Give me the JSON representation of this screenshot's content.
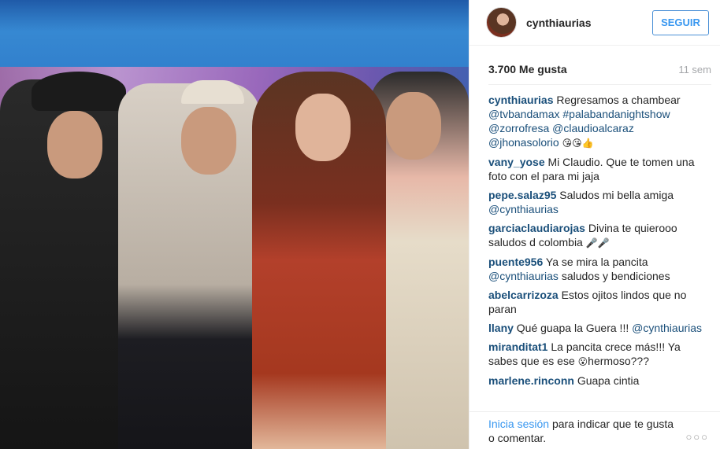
{
  "post": {
    "photo": {
      "alt_icon": "photo"
    },
    "author": {
      "username": "cynthiaurias"
    },
    "follow_label": "SEGUIR",
    "likes": "3.700 Me gusta",
    "time": "11 sem"
  },
  "caption": {
    "user": "cynthiaurias",
    "text": "Regresamos a chambear",
    "tags": [
      "@tvbandamax",
      "#palabandanightshow",
      "@zorrofresa",
      "@claudioalcaraz",
      "@jhonasolorio"
    ],
    "emoji": "😘😘👍"
  },
  "comments": [
    {
      "user": "vany_yose",
      "text": "Mi Claudio. Que te tomen una foto con el para mi jaja"
    },
    {
      "user": "pepe.salaz95",
      "text": "Saludos mi bella amiga",
      "tag": "@cynthiaurias"
    },
    {
      "user": "garciaclaudiarojas",
      "text": "Divina te quierooo saludos d colombia",
      "emoji": "🎤🎤"
    },
    {
      "user": "puente956",
      "text": "Ya se mira la pancita",
      "tag": "@cynthiaurias",
      "after": "saludos y bendiciones"
    },
    {
      "user": "abelcarrizoza",
      "text": "Estos ojitos lindos que no paran"
    },
    {
      "user": "llany",
      "text": "Qué guapa la Guera !!!",
      "tag": "@cynthiaurias"
    },
    {
      "user": "miranditat1",
      "text": "La pancita crece más!!! Ya sabes que es ese",
      "emoji": "😮",
      "after": "hermoso???"
    },
    {
      "user": "marlene.rinconn",
      "text": "Guapa cintia"
    }
  ],
  "footer": {
    "login_link": "Inicia sesión",
    "login_rest": "para indicar que te gusta o comentar.",
    "more_icon": "more-icon"
  }
}
